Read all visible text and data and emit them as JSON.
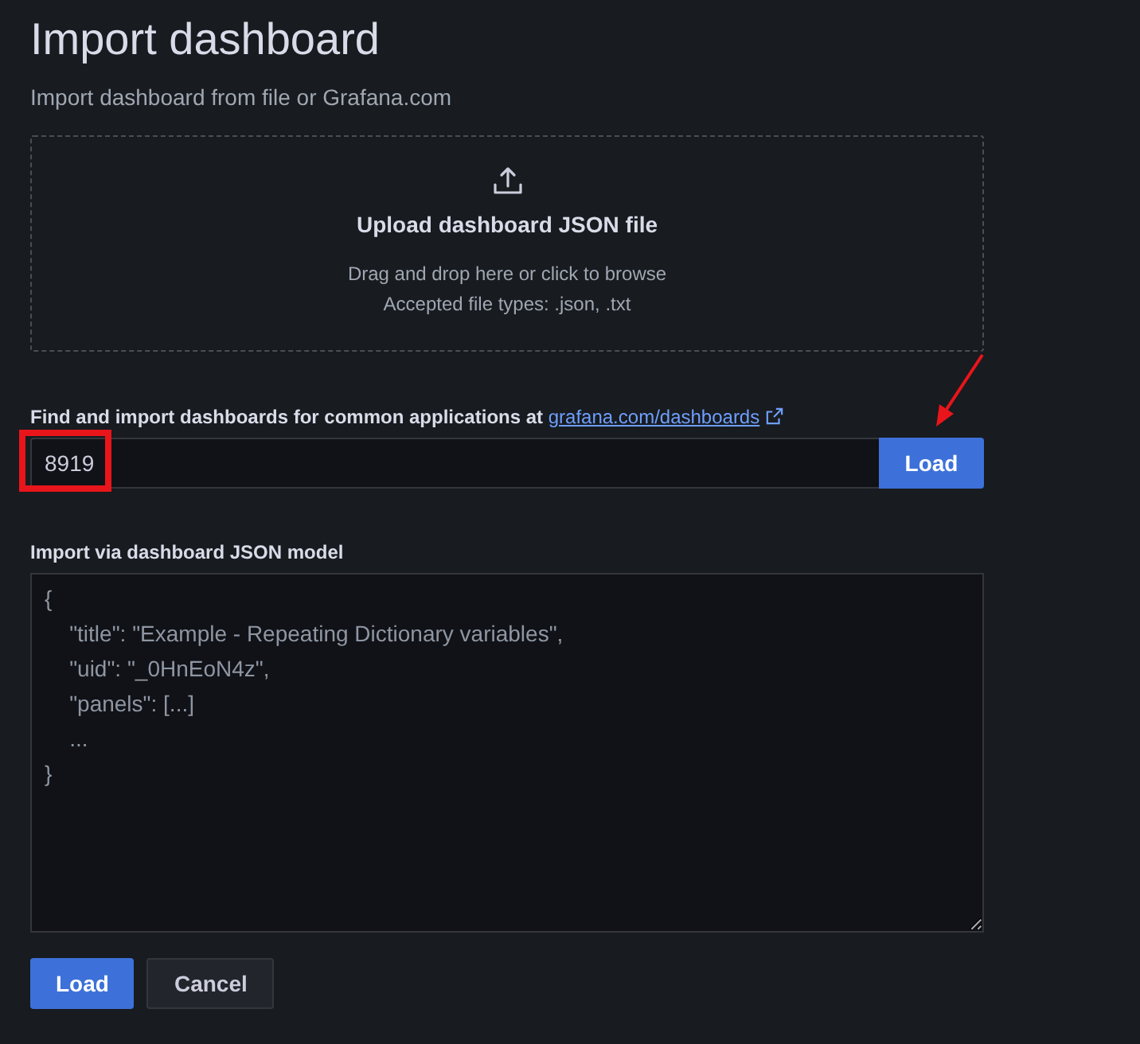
{
  "page": {
    "title": "Import dashboard",
    "subtitle": "Import dashboard from file or Grafana.com"
  },
  "upload": {
    "title": "Upload dashboard JSON file",
    "hint": "Drag and drop here or click to browse",
    "types": "Accepted file types: .json, .txt"
  },
  "grafana_import": {
    "label": "Find and import dashboards for common applications at ",
    "link": "grafana.com/dashboards",
    "value": "8919",
    "button": "Load"
  },
  "json_model": {
    "label": "Import via dashboard JSON model",
    "placeholder": "{\n    \"title\": \"Example - Repeating Dictionary variables\",\n    \"uid\": \"_0HnEoN4z\",\n    \"panels\": [...]\n    ...\n}"
  },
  "buttons": [
    {
      "label": "Load",
      "kind": "primary"
    },
    {
      "label": "Cancel",
      "kind": "secondary"
    }
  ]
}
